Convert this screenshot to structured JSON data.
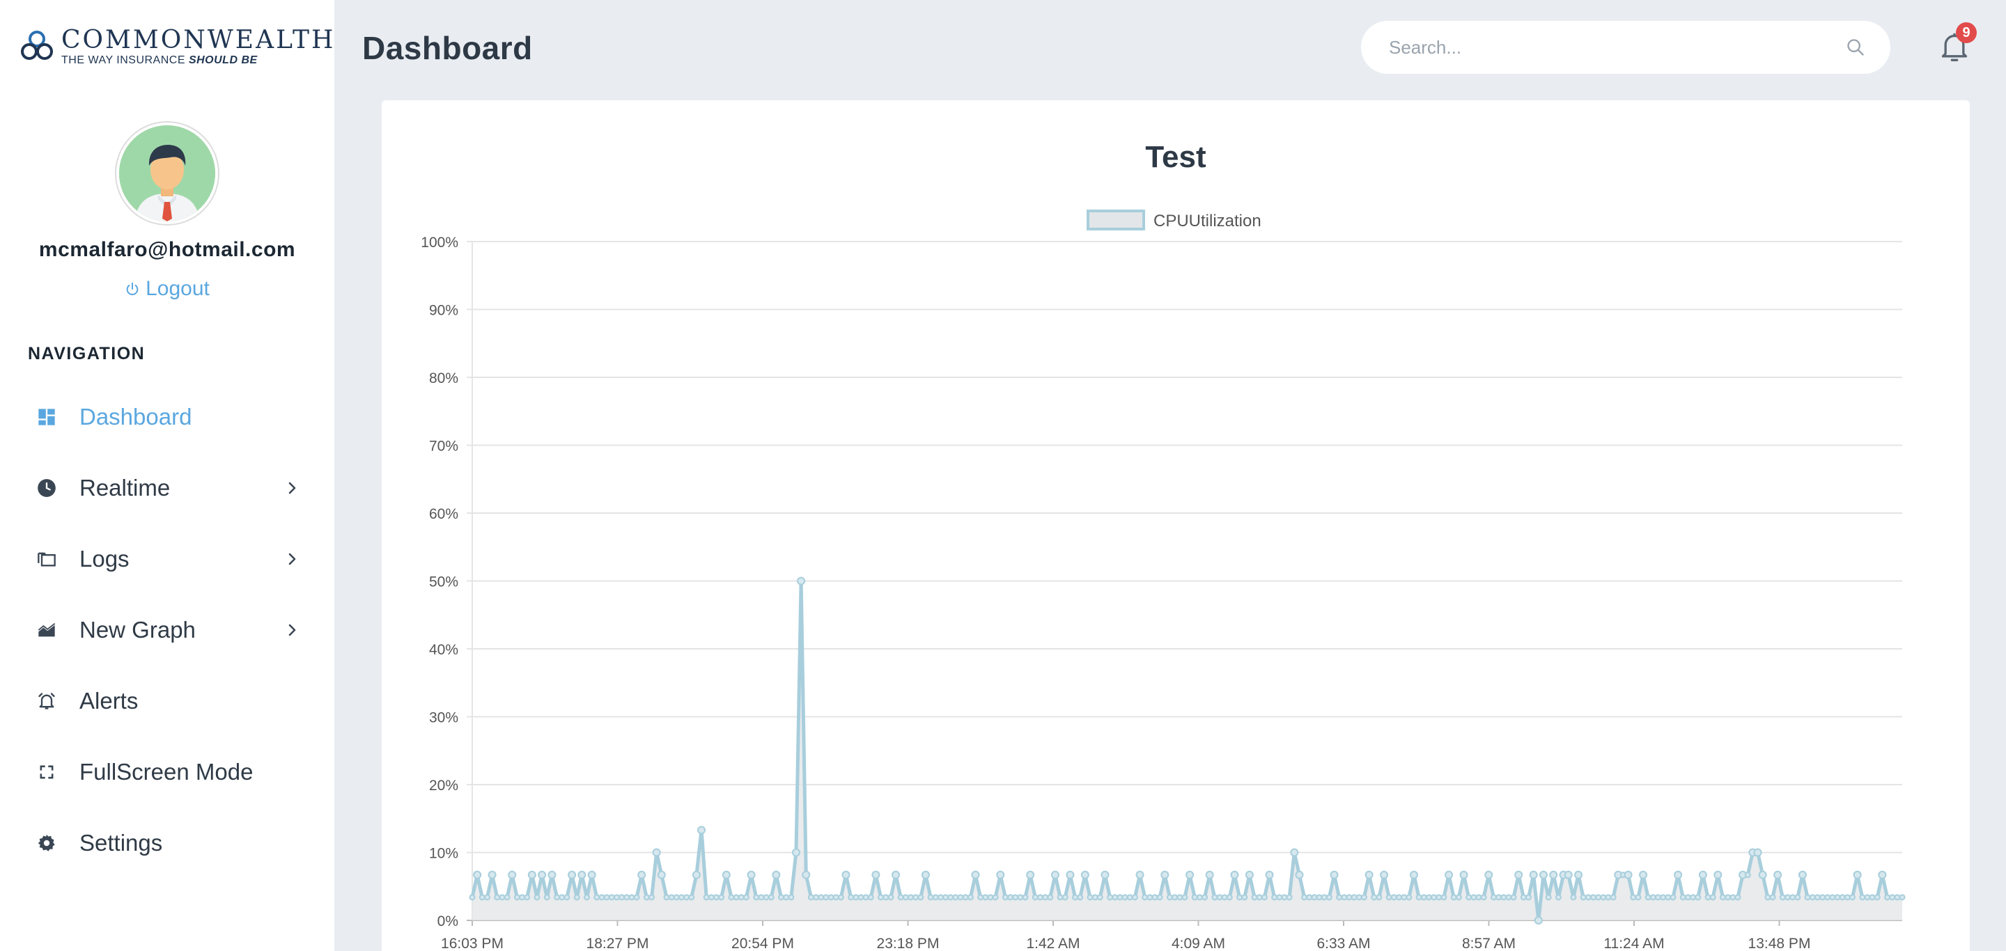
{
  "brand": {
    "name": "COMMONWEALTH",
    "tagline_prefix": "THE WAY INSURANCE",
    "tagline_emphasis": "SHOULD BE"
  },
  "user": {
    "email": "mcmalfaro@hotmail.com",
    "logout_label": "Logout"
  },
  "nav": {
    "heading": "NAVIGATION",
    "items": [
      {
        "label": "Dashboard",
        "icon": "dashboard-icon",
        "active": true,
        "has_submenu": false
      },
      {
        "label": "Realtime",
        "icon": "clock-icon",
        "active": false,
        "has_submenu": true
      },
      {
        "label": "Logs",
        "icon": "folders-icon",
        "active": false,
        "has_submenu": true
      },
      {
        "label": "New Graph",
        "icon": "area-chart-icon",
        "active": false,
        "has_submenu": true
      },
      {
        "label": "Alerts",
        "icon": "alarm-bell-icon",
        "active": false,
        "has_submenu": false
      },
      {
        "label": "FullScreen Mode",
        "icon": "fullscreen-icon",
        "active": false,
        "has_submenu": false
      },
      {
        "label": "Settings",
        "icon": "gear-icon",
        "active": false,
        "has_submenu": false
      }
    ]
  },
  "header": {
    "title": "Dashboard",
    "search_placeholder": "Search...",
    "notification_count": "9"
  },
  "colors": {
    "accent": "#5aa7e0",
    "series_line": "#a8cedc",
    "series_fill": "#e3e6e8",
    "badge": "#e24b4b"
  },
  "chart_data": {
    "type": "line",
    "title": "Test",
    "legend": [
      "CPUUtilization"
    ],
    "legend_position": "top-center",
    "grid": true,
    "ylim": [
      0,
      100
    ],
    "y_tick_labels": [
      "0%",
      "10%",
      "20%",
      "30%",
      "40%",
      "50%",
      "60%",
      "70%",
      "80%",
      "90%",
      "100%"
    ],
    "x_tick_labels": [
      "16:03 PM",
      "18:27 PM",
      "20:54 PM",
      "23:18 PM",
      "1:42 AM",
      "4:09 AM",
      "6:33 AM",
      "8:57 AM",
      "11:24 AM",
      "13:48 PM"
    ],
    "series": [
      {
        "name": "CPUUtilization",
        "values": [
          3.4,
          6.7,
          3.4,
          3.4,
          6.7,
          3.4,
          3.4,
          3.4,
          6.7,
          3.4,
          3.4,
          3.4,
          6.7,
          3.4,
          6.7,
          3.4,
          6.7,
          3.4,
          3.4,
          3.4,
          6.7,
          3.4,
          6.7,
          3.4,
          6.7,
          3.4,
          3.4,
          3.4,
          3.4,
          3.4,
          3.4,
          3.4,
          3.4,
          3.4,
          6.7,
          3.4,
          3.4,
          10.0,
          6.7,
          3.4,
          3.4,
          3.4,
          3.4,
          3.4,
          3.4,
          6.7,
          13.3,
          3.4,
          3.4,
          3.4,
          3.4,
          6.7,
          3.4,
          3.4,
          3.4,
          3.4,
          6.7,
          3.4,
          3.4,
          3.4,
          3.4,
          6.7,
          3.4,
          3.4,
          3.4,
          10.0,
          50.0,
          6.7,
          3.4,
          3.4,
          3.4,
          3.4,
          3.4,
          3.4,
          3.4,
          6.7,
          3.4,
          3.4,
          3.4,
          3.4,
          3.4,
          6.7,
          3.4,
          3.4,
          3.4,
          6.7,
          3.4,
          3.4,
          3.4,
          3.4,
          3.4,
          6.7,
          3.4,
          3.4,
          3.4,
          3.4,
          3.4,
          3.4,
          3.4,
          3.4,
          3.4,
          6.7,
          3.4,
          3.4,
          3.4,
          3.4,
          6.7,
          3.4,
          3.4,
          3.4,
          3.4,
          3.4,
          6.7,
          3.4,
          3.4,
          3.4,
          3.4,
          6.7,
          3.4,
          3.4,
          6.7,
          3.4,
          3.4,
          6.7,
          3.4,
          3.4,
          3.4,
          6.7,
          3.4,
          3.4,
          3.4,
          3.4,
          3.4,
          3.4,
          6.7,
          3.4,
          3.4,
          3.4,
          3.4,
          6.7,
          3.4,
          3.4,
          3.4,
          3.4,
          6.7,
          3.4,
          3.4,
          3.4,
          6.7,
          3.4,
          3.4,
          3.4,
          3.4,
          6.7,
          3.4,
          3.4,
          6.7,
          3.4,
          3.4,
          3.4,
          6.7,
          3.4,
          3.4,
          3.4,
          3.4,
          10.0,
          6.7,
          3.4,
          3.4,
          3.4,
          3.4,
          3.4,
          3.4,
          6.7,
          3.4,
          3.4,
          3.4,
          3.4,
          3.4,
          3.4,
          6.7,
          3.4,
          3.4,
          6.7,
          3.4,
          3.4,
          3.4,
          3.4,
          3.4,
          6.7,
          3.4,
          3.4,
          3.4,
          3.4,
          3.4,
          3.4,
          6.7,
          3.4,
          3.4,
          6.7,
          3.4,
          3.4,
          3.4,
          3.4,
          6.7,
          3.4,
          3.4,
          3.4,
          3.4,
          3.4,
          6.7,
          3.4,
          3.4,
          6.7,
          0.0,
          6.7,
          3.4,
          6.7,
          3.4,
          6.7,
          6.7,
          3.4,
          6.7,
          3.4,
          3.4,
          3.4,
          3.4,
          3.4,
          3.4,
          3.4,
          6.7,
          6.7,
          6.7,
          3.4,
          3.4,
          6.7,
          3.4,
          3.4,
          3.4,
          3.4,
          3.4,
          3.4,
          6.7,
          3.4,
          3.4,
          3.4,
          3.4,
          6.7,
          3.4,
          3.4,
          6.7,
          3.4,
          3.4,
          3.4,
          3.4,
          6.7,
          6.7,
          10.0,
          10.0,
          6.7,
          3.4,
          3.4,
          6.7,
          3.4,
          3.4,
          3.4,
          3.4,
          6.7,
          3.4,
          3.4,
          3.4,
          3.4,
          3.4,
          3.4,
          3.4,
          3.4,
          3.4,
          3.4,
          6.7,
          3.4,
          3.4,
          3.4,
          3.4,
          6.7,
          3.4,
          3.4,
          3.4,
          3.4
        ]
      }
    ]
  }
}
